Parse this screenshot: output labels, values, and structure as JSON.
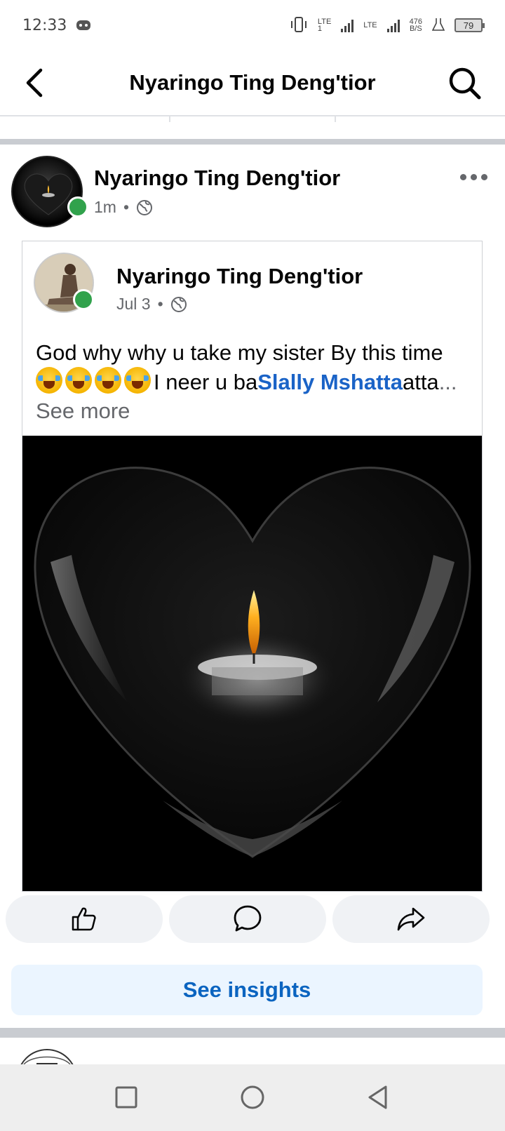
{
  "status_bar": {
    "time": "12:33",
    "lte1": "LTE",
    "lte1_sub": "1",
    "lte2": "LTE",
    "speed_value": "476",
    "speed_unit": "B/S",
    "battery": "79"
  },
  "header": {
    "title": "Nyaringo Ting Deng'tior",
    "back_icon": "chevron-left-icon",
    "search_icon": "search-icon"
  },
  "post": {
    "author": "Nyaringo Ting Deng'tior",
    "time": "1m",
    "separator": "•",
    "privacy_icon": "globe-icon",
    "more_icon": "more-horizontal-icon"
  },
  "shared_post": {
    "author": "Nyaringo Ting Deng'tior",
    "date": "Jul 3",
    "separator": "•",
    "privacy_icon": "globe-icon",
    "text_part1": "God why why u take my sister By this time ",
    "emoji_name": "loudly-crying-face-emoji",
    "emoji_count": 4,
    "text_part2": "I neer u ba",
    "mention": "Slally Mshatta",
    "text_part3": "atta",
    "see_more": "... See more",
    "image_icon": "heart-candle-image"
  },
  "actions": {
    "like_icon": "thumbs-up-icon",
    "comment_icon": "comment-icon",
    "share_icon": "share-icon",
    "insights_label": "See insights"
  },
  "nav_bar": {
    "recents_icon": "square-icon",
    "home_icon": "circle-icon",
    "back_icon": "triangle-back-icon"
  },
  "colors": {
    "accent": "#0b64c0",
    "mention": "#1a63c7",
    "online": "#31a24c",
    "secondary_text": "#65676b",
    "button_bg": "#f0f2f5",
    "insights_bg": "#ebf5ff"
  }
}
